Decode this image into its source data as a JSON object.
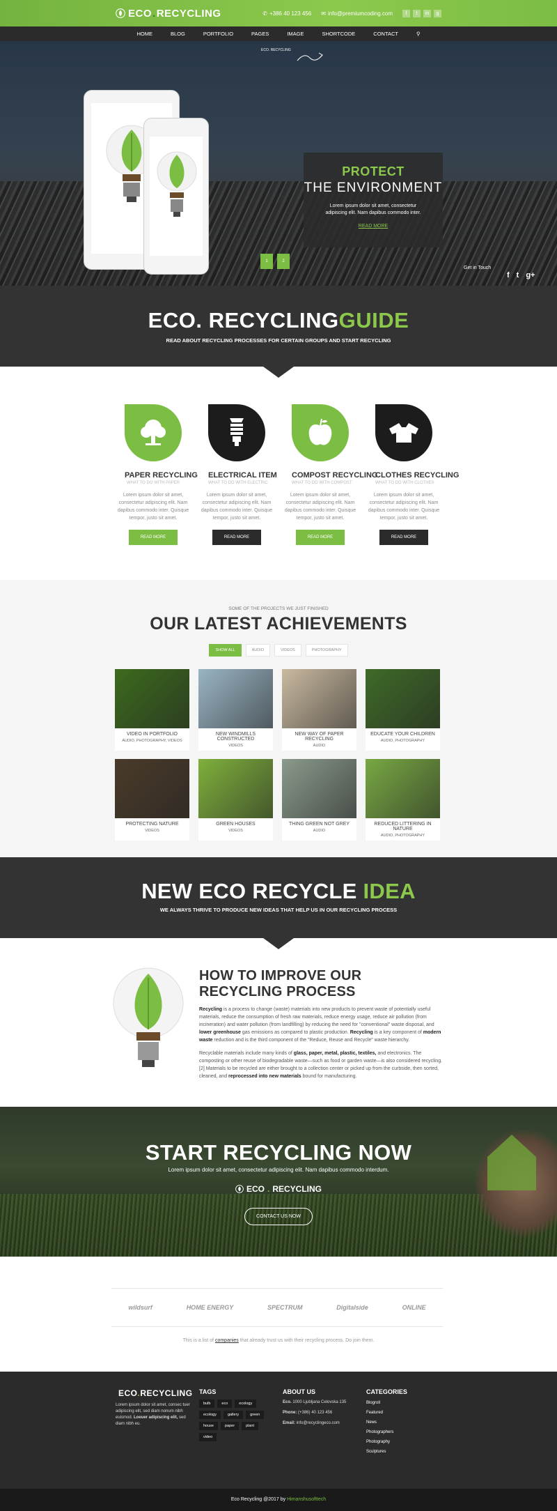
{
  "brand": {
    "name_a": "ECO",
    "dot": ".",
    "name_b": "RECYCLING"
  },
  "topbar": {
    "phone": "+386 40 123 456",
    "email": "info@premiumcoding.com",
    "social": [
      "f",
      "t",
      "in",
      "g"
    ]
  },
  "nav": [
    "HOME",
    "BLOG",
    "PORTFOLIO",
    "PAGES",
    "IMAGE",
    "SHORTCODE",
    "CONTACT"
  ],
  "hero": {
    "brandmark": "ECO. RECYCLING",
    "promo_line1": "PROTECT",
    "promo_line2": "THE ENVIRONMENT",
    "promo_text": "Lorem ipsum dolor sit amet, consectetur adipiscing elit. Nam dapibus commodo inter.",
    "promo_link": "READ MORE",
    "slides": [
      "1",
      "2"
    ],
    "get_in_touch": "Get in Touch",
    "social": [
      "f",
      "t",
      "g+"
    ]
  },
  "guide": {
    "title_a": "ECO. RECYCLING",
    "title_b": "GUIDE",
    "subtitle": "READ ABOUT RECYCLING PROCESSES FOR CERTAIN GROUPS AND START RECYCLING"
  },
  "cards": [
    {
      "title": "PAPER RECYCLING",
      "sub": "WHAT TO DO WITH PAPER",
      "text": "Lorem ipsum dolor sit amet, consectetur adipiscing elit. Nam dapibus commodo inter. Quisque tempor, justo sit amet.",
      "button": "READ MORE",
      "icon": "tree-icon",
      "color": "green"
    },
    {
      "title": "ELECTRICAL ITEM",
      "sub": "WHAT TO DO WITH ELECTRIC",
      "text": "Lorem ipsum dolor sit amet, consectetur adipiscing elit. Nam dapibus commodo inter. Quisque tempor, justo sit amet.",
      "button": "READ MORE",
      "icon": "bulb-icon",
      "color": "black"
    },
    {
      "title": "COMPOST RECYCLING",
      "sub": "WHAT TO DO WITH COMPOST",
      "text": "Lorem ipsum dolor sit amet, consectetur adipiscing elit. Nam dapibus commodo inter. Quisque tempor, justo sit amet.",
      "button": "READ MORE",
      "icon": "apple-icon",
      "color": "green"
    },
    {
      "title": "CLOTHES RECYCLING",
      "sub": "WHAT TO DO WITH CLOTHES",
      "text": "Lorem ipsum dolor sit amet, consectetur adipiscing elit. Nam dapibus commodo inter. Quisque tempor, justo sit amet.",
      "button": "READ MORE",
      "icon": "shirt-icon",
      "color": "black"
    }
  ],
  "achievements": {
    "kicker": "SOME OF THE PROJECTS WE JUST FINISHED",
    "title": "OUR LATEST ACHIEVEMENTS",
    "filters": [
      "SHOW ALL",
      "AUDIO",
      "VIDEOS",
      "PHOTOGRAPHY"
    ],
    "tiles": [
      {
        "title": "VIDEO IN PORTFOLIO",
        "cats": "AUDIO, PHOTOGRAPHY, VIDEOS",
        "bg": "#3d6b1e"
      },
      {
        "title": "NEW WINDMILLS CONSTRUCTED",
        "cats": "VIDEOS",
        "bg": "#9ab5c4"
      },
      {
        "title": "NEW WAY OF PAPER RECYCLING",
        "cats": "AUDIO",
        "bg": "#c9b9a0"
      },
      {
        "title": "EDUCATE YOUR CHILDREN",
        "cats": "AUDIO, PHOTOGRAPHY",
        "bg": "#3f6a28"
      },
      {
        "title": "PROTECTING NATURE",
        "cats": "VIDEOS",
        "bg": "#4a3b2a"
      },
      {
        "title": "GREEN HOUSES",
        "cats": "VIDEOS",
        "bg": "#7fb03c"
      },
      {
        "title": "THING GREEN NOT GREY",
        "cats": "AUDIO",
        "bg": "#8a9a8c"
      },
      {
        "title": "REDUCED LITTERING IN NATURE",
        "cats": "AUDIO, PHOTOGRAPHY",
        "bg": "#78a843"
      }
    ]
  },
  "idea": {
    "title_a": "NEW ECO RECYCLE ",
    "title_b": "IDEA",
    "subtitle": "WE ALWAYS THRIVE TO PRODUCE NEW IDEAS THAT HELP US IN OUR RECYCLING PROCESS"
  },
  "improve": {
    "title": "HOW TO IMPROVE OUR RECYCLING PROCESS",
    "p1_a": "Recycling",
    "p1_b": " is a process to change (waste) materials into new products to prevent waste of potentially useful materials, reduce the consumption of fresh raw materials, reduce energy usage, reduce air pollution (from incineration) and water pollution (from landfilling) by reducing the need for \"conventional\" waste disposal, and ",
    "p1_c": "lower greenhouse",
    "p1_d": " gas emissions as compared to plastic production. ",
    "p1_e": "Recycling",
    "p1_f": " is a key component of ",
    "p1_g": "modern waste",
    "p1_h": " reduction and is the third component of the \"Reduce, Reuse and Recycle\" waste hierarchy.",
    "p2_a": "Recyclable materials include many kinds of ",
    "p2_b": "glass, paper, metal, plastic, textiles,",
    "p2_c": " and electronics. The composting or other reuse of biodegradable waste—such as food or garden waste—is also considered recycling.[2] Materials to be recycled are either brought to a collection center or picked up from the curbside, then sorted, cleaned, and ",
    "p2_d": "reprocessed into new materials",
    "p2_e": " bound for manufacturing."
  },
  "start": {
    "title": "START RECYCLING NOW",
    "subtitle": "Lorem ipsum dolor sit amet, consectetur adipiscing elit. Nam dapibus commodo interdum.",
    "button": "CONTACT US NOW"
  },
  "partners": {
    "logos": [
      "wildsurf",
      "HOME ENERGY",
      "SPECTRUM",
      "Digitalside",
      "ONLINE"
    ],
    "note_a": "This is a list of ",
    "note_b": "companies",
    "note_c": " that already trust us with their recycling process. Do join them."
  },
  "footer": {
    "about_text_a": "Lorem ipsum dolor sit amet, consec tuer adipiscing elit, sed diam nonum nibh euismod. ",
    "about_text_b": "Loeuer adipiscing elit,",
    "about_text_c": " sed diam nibh eu.",
    "tags_title": "TAGS",
    "tags": [
      "bulb",
      "eco",
      "ecology",
      "ecology",
      "gallery",
      "green",
      "house",
      "paper",
      "plant",
      "video"
    ],
    "about_title": "ABOUT US",
    "address_a": "Eco.",
    "address_b": " 1000 Ljubljana Celovska 135",
    "phone_a": "Phone:",
    "phone_b": " (+386) 40 123 456",
    "email_a": "Email:",
    "email_b": " info@recyclingeco.com",
    "cats_title": "CATEGORIES",
    "categories": [
      "Blogroll",
      "Featured",
      "News",
      "Photographers",
      "Photography",
      "Sculptures"
    ]
  },
  "bottom": {
    "a": "Eco Recycling @2017 by ",
    "b": "Himanshusofttech"
  }
}
